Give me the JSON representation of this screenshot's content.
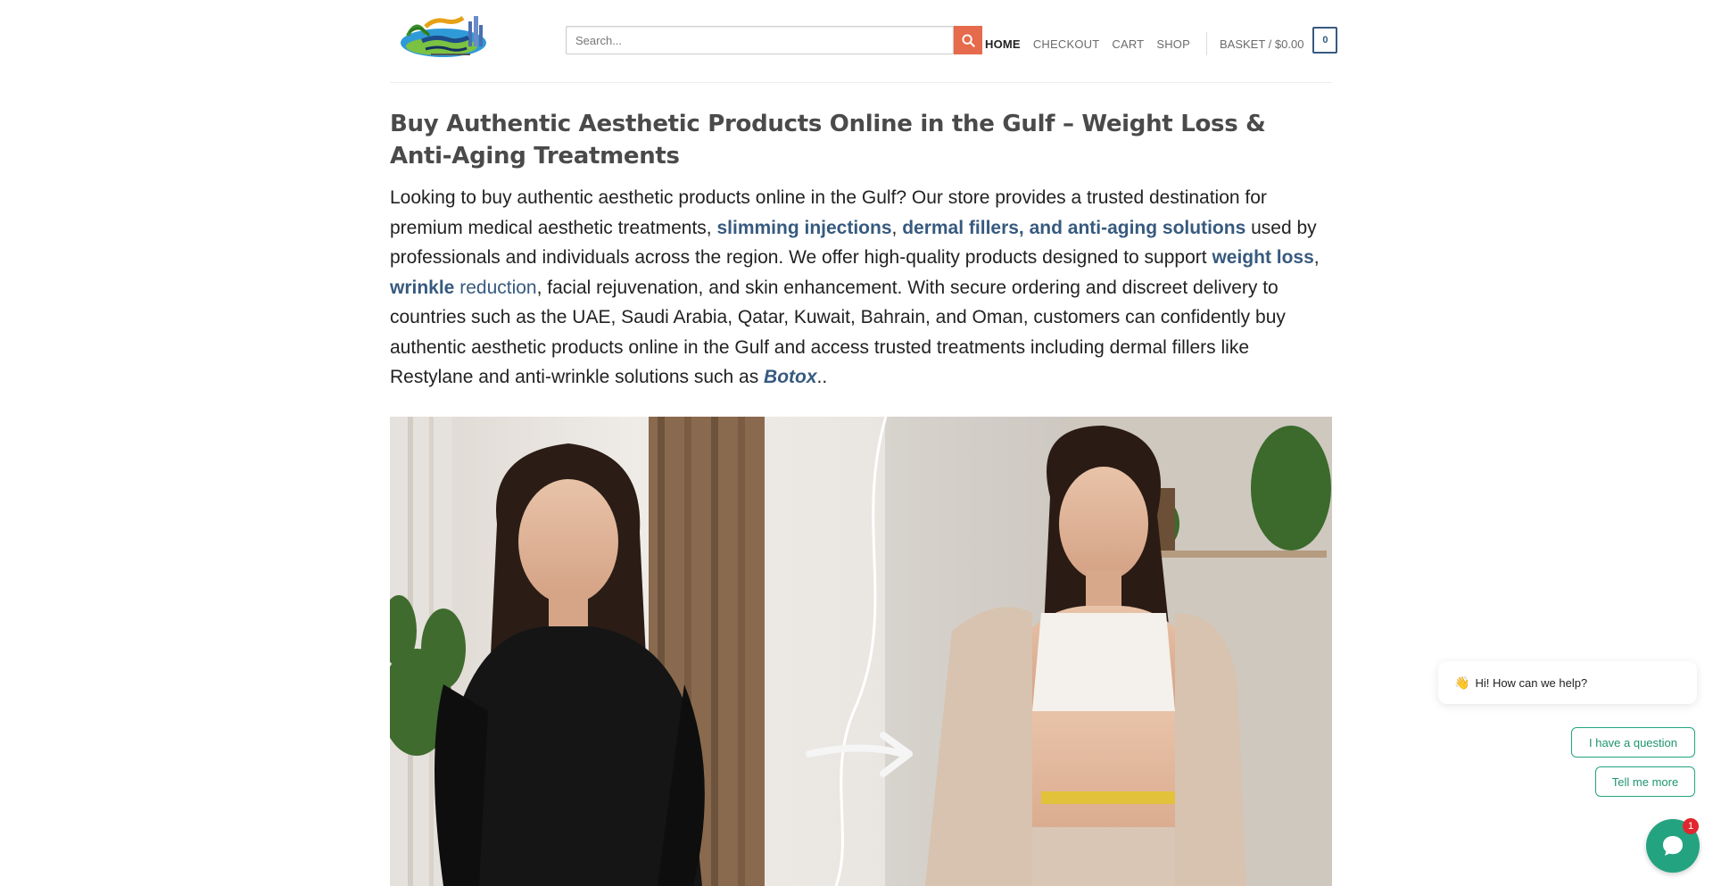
{
  "header": {
    "logo_alt": "store logo",
    "search": {
      "placeholder": "Search..."
    },
    "nav": [
      {
        "label": "HOME",
        "active": true
      },
      {
        "label": "CHECKOUT",
        "active": false
      },
      {
        "label": "CART",
        "active": false
      },
      {
        "label": "SHOP",
        "active": false
      }
    ],
    "basket_label": "BASKET / $0.00",
    "basket_count": "0"
  },
  "main": {
    "title": "Buy Authentic Aesthetic Products Online in the Gulf – Weight Loss & Anti-Aging Treatments",
    "intro": {
      "t1": "Looking to buy authentic aesthetic products online in the Gulf? Our store provides a trusted destination for premium medical aesthetic treatments, ",
      "link1": "slimming injections",
      "t2": ", ",
      "link2": "dermal fillers, and anti-aging solutions",
      "t3": " used by professionals and individuals across the region. We offer high-quality products designed to support ",
      "link3": "weight loss",
      "t4": ", ",
      "link4": "wrinkle",
      "t5": " ",
      "link5": "reduction",
      "t6": ", facial rejuvenation, and skin enhancement. With secure ordering and discreet delivery to countries such as the UAE, Saudi Arabia, Qatar, Kuwait, Bahrain, and Oman, customers can confidently buy authentic aesthetic products online in the Gulf and access trusted treatments including dermal fillers like Restylane and anti-wrinkle solutions such as ",
      "emph": "Botox",
      "t7": ".."
    }
  },
  "chat": {
    "greeting_emoji": "👋",
    "greeting": "Hi! How can we help?",
    "options": [
      "I have a question",
      "Tell me more"
    ],
    "badge": "1"
  },
  "colors": {
    "accent": "#e66a4c",
    "link": "#375a7f",
    "chat": "#23a380",
    "badge": "#e0262f"
  }
}
